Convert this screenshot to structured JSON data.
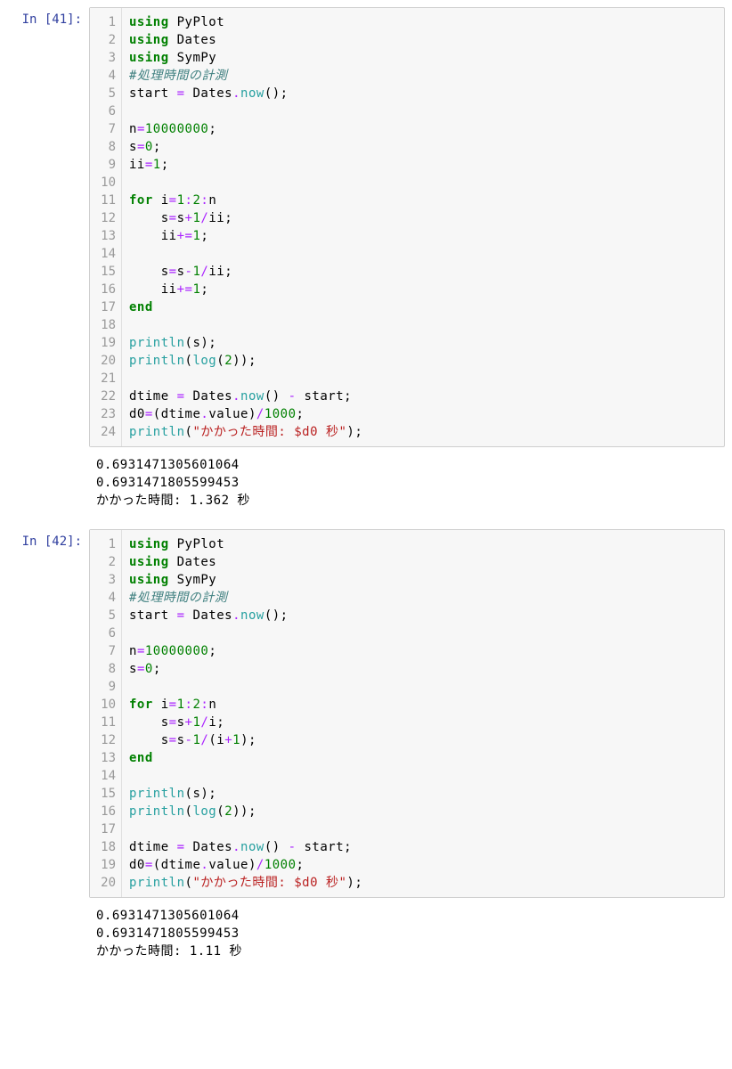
{
  "cells": [
    {
      "prompt": "In [41]:",
      "lineCount": 24,
      "code": [
        [
          {
            "c": "k",
            "t": "using"
          },
          {
            "c": "nm",
            "t": " PyPlot"
          }
        ],
        [
          {
            "c": "k",
            "t": "using"
          },
          {
            "c": "nm",
            "t": " Dates"
          }
        ],
        [
          {
            "c": "k",
            "t": "using"
          },
          {
            "c": "nm",
            "t": " SymPy"
          }
        ],
        [
          {
            "c": "cm",
            "t": "#処理時間の計測"
          }
        ],
        [
          {
            "c": "nm",
            "t": "start "
          },
          {
            "c": "op",
            "t": "="
          },
          {
            "c": "nm",
            "t": " Dates"
          },
          {
            "c": "op",
            "t": "."
          },
          {
            "c": "fn",
            "t": "now"
          },
          {
            "c": "nm",
            "t": "();"
          }
        ],
        [],
        [
          {
            "c": "nm",
            "t": "n"
          },
          {
            "c": "op",
            "t": "="
          },
          {
            "c": "nlit",
            "t": "10000000"
          },
          {
            "c": "nm",
            "t": ";"
          }
        ],
        [
          {
            "c": "nm",
            "t": "s"
          },
          {
            "c": "op",
            "t": "="
          },
          {
            "c": "nlit",
            "t": "0"
          },
          {
            "c": "nm",
            "t": ";"
          }
        ],
        [
          {
            "c": "nm",
            "t": "ii"
          },
          {
            "c": "op",
            "t": "="
          },
          {
            "c": "nlit",
            "t": "1"
          },
          {
            "c": "nm",
            "t": ";"
          }
        ],
        [],
        [
          {
            "c": "k",
            "t": "for"
          },
          {
            "c": "nm",
            "t": " i"
          },
          {
            "c": "op",
            "t": "="
          },
          {
            "c": "nlit",
            "t": "1"
          },
          {
            "c": "op",
            "t": ":"
          },
          {
            "c": "nlit",
            "t": "2"
          },
          {
            "c": "op",
            "t": ":"
          },
          {
            "c": "nm",
            "t": "n"
          }
        ],
        [
          {
            "c": "nm",
            "t": "    s"
          },
          {
            "c": "op",
            "t": "="
          },
          {
            "c": "nm",
            "t": "s"
          },
          {
            "c": "op",
            "t": "+"
          },
          {
            "c": "nlit",
            "t": "1"
          },
          {
            "c": "op",
            "t": "/"
          },
          {
            "c": "nm",
            "t": "ii;"
          }
        ],
        [
          {
            "c": "nm",
            "t": "    ii"
          },
          {
            "c": "op",
            "t": "+="
          },
          {
            "c": "nlit",
            "t": "1"
          },
          {
            "c": "nm",
            "t": ";"
          }
        ],
        [],
        [
          {
            "c": "nm",
            "t": "    s"
          },
          {
            "c": "op",
            "t": "="
          },
          {
            "c": "nm",
            "t": "s"
          },
          {
            "c": "op",
            "t": "-"
          },
          {
            "c": "nlit",
            "t": "1"
          },
          {
            "c": "op",
            "t": "/"
          },
          {
            "c": "nm",
            "t": "ii;"
          }
        ],
        [
          {
            "c": "nm",
            "t": "    ii"
          },
          {
            "c": "op",
            "t": "+="
          },
          {
            "c": "nlit",
            "t": "1"
          },
          {
            "c": "nm",
            "t": ";"
          }
        ],
        [
          {
            "c": "k",
            "t": "end"
          }
        ],
        [],
        [
          {
            "c": "fn",
            "t": "println"
          },
          {
            "c": "nm",
            "t": "(s);"
          }
        ],
        [
          {
            "c": "fn",
            "t": "println"
          },
          {
            "c": "nm",
            "t": "("
          },
          {
            "c": "fn",
            "t": "log"
          },
          {
            "c": "nm",
            "t": "("
          },
          {
            "c": "nlit",
            "t": "2"
          },
          {
            "c": "nm",
            "t": "));"
          }
        ],
        [],
        [
          {
            "c": "nm",
            "t": "dtime "
          },
          {
            "c": "op",
            "t": "="
          },
          {
            "c": "nm",
            "t": " Dates"
          },
          {
            "c": "op",
            "t": "."
          },
          {
            "c": "fn",
            "t": "now"
          },
          {
            "c": "nm",
            "t": "() "
          },
          {
            "c": "op",
            "t": "-"
          },
          {
            "c": "nm",
            "t": " start;"
          }
        ],
        [
          {
            "c": "nm",
            "t": "d0"
          },
          {
            "c": "op",
            "t": "="
          },
          {
            "c": "nm",
            "t": "(dtime"
          },
          {
            "c": "op",
            "t": "."
          },
          {
            "c": "nm",
            "t": "value)"
          },
          {
            "c": "op",
            "t": "/"
          },
          {
            "c": "nlit",
            "t": "1000"
          },
          {
            "c": "nm",
            "t": ";"
          }
        ],
        [
          {
            "c": "fn",
            "t": "println"
          },
          {
            "c": "nm",
            "t": "("
          },
          {
            "c": "str",
            "t": "\"かかった時間: $d0 秒\""
          },
          {
            "c": "nm",
            "t": ");"
          }
        ]
      ],
      "output": [
        "0.6931471305601064",
        "0.6931471805599453",
        "かかった時間: 1.362 秒"
      ]
    },
    {
      "prompt": "In [42]:",
      "lineCount": 20,
      "code": [
        [
          {
            "c": "k",
            "t": "using"
          },
          {
            "c": "nm",
            "t": " PyPlot"
          }
        ],
        [
          {
            "c": "k",
            "t": "using"
          },
          {
            "c": "nm",
            "t": " Dates"
          }
        ],
        [
          {
            "c": "k",
            "t": "using"
          },
          {
            "c": "nm",
            "t": " SymPy"
          }
        ],
        [
          {
            "c": "cm",
            "t": "#処理時間の計測"
          }
        ],
        [
          {
            "c": "nm",
            "t": "start "
          },
          {
            "c": "op",
            "t": "="
          },
          {
            "c": "nm",
            "t": " Dates"
          },
          {
            "c": "op",
            "t": "."
          },
          {
            "c": "fn",
            "t": "now"
          },
          {
            "c": "nm",
            "t": "();"
          }
        ],
        [],
        [
          {
            "c": "nm",
            "t": "n"
          },
          {
            "c": "op",
            "t": "="
          },
          {
            "c": "nlit",
            "t": "10000000"
          },
          {
            "c": "nm",
            "t": ";"
          }
        ],
        [
          {
            "c": "nm",
            "t": "s"
          },
          {
            "c": "op",
            "t": "="
          },
          {
            "c": "nlit",
            "t": "0"
          },
          {
            "c": "nm",
            "t": ";"
          }
        ],
        [],
        [
          {
            "c": "k",
            "t": "for"
          },
          {
            "c": "nm",
            "t": " i"
          },
          {
            "c": "op",
            "t": "="
          },
          {
            "c": "nlit",
            "t": "1"
          },
          {
            "c": "op",
            "t": ":"
          },
          {
            "c": "nlit",
            "t": "2"
          },
          {
            "c": "op",
            "t": ":"
          },
          {
            "c": "nm",
            "t": "n"
          }
        ],
        [
          {
            "c": "nm",
            "t": "    s"
          },
          {
            "c": "op",
            "t": "="
          },
          {
            "c": "nm",
            "t": "s"
          },
          {
            "c": "op",
            "t": "+"
          },
          {
            "c": "nlit",
            "t": "1"
          },
          {
            "c": "op",
            "t": "/"
          },
          {
            "c": "nm",
            "t": "i;"
          }
        ],
        [
          {
            "c": "nm",
            "t": "    s"
          },
          {
            "c": "op",
            "t": "="
          },
          {
            "c": "nm",
            "t": "s"
          },
          {
            "c": "op",
            "t": "-"
          },
          {
            "c": "nlit",
            "t": "1"
          },
          {
            "c": "op",
            "t": "/"
          },
          {
            "c": "nm",
            "t": "(i"
          },
          {
            "c": "op",
            "t": "+"
          },
          {
            "c": "nlit",
            "t": "1"
          },
          {
            "c": "nm",
            "t": ");"
          }
        ],
        [
          {
            "c": "k",
            "t": "end"
          }
        ],
        [],
        [
          {
            "c": "fn",
            "t": "println"
          },
          {
            "c": "nm",
            "t": "(s);"
          }
        ],
        [
          {
            "c": "fn",
            "t": "println"
          },
          {
            "c": "nm",
            "t": "("
          },
          {
            "c": "fn",
            "t": "log"
          },
          {
            "c": "nm",
            "t": "("
          },
          {
            "c": "nlit",
            "t": "2"
          },
          {
            "c": "nm",
            "t": "));"
          }
        ],
        [],
        [
          {
            "c": "nm",
            "t": "dtime "
          },
          {
            "c": "op",
            "t": "="
          },
          {
            "c": "nm",
            "t": " Dates"
          },
          {
            "c": "op",
            "t": "."
          },
          {
            "c": "fn",
            "t": "now"
          },
          {
            "c": "nm",
            "t": "() "
          },
          {
            "c": "op",
            "t": "-"
          },
          {
            "c": "nm",
            "t": " start;"
          }
        ],
        [
          {
            "c": "nm",
            "t": "d0"
          },
          {
            "c": "op",
            "t": "="
          },
          {
            "c": "nm",
            "t": "(dtime"
          },
          {
            "c": "op",
            "t": "."
          },
          {
            "c": "nm",
            "t": "value)"
          },
          {
            "c": "op",
            "t": "/"
          },
          {
            "c": "nlit",
            "t": "1000"
          },
          {
            "c": "nm",
            "t": ";"
          }
        ],
        [
          {
            "c": "fn",
            "t": "println"
          },
          {
            "c": "nm",
            "t": "("
          },
          {
            "c": "str",
            "t": "\"かかった時間: $d0 秒\""
          },
          {
            "c": "nm",
            "t": ");"
          }
        ]
      ],
      "output": [
        "0.6931471305601064",
        "0.6931471805599453",
        "かかった時間: 1.11 秒"
      ]
    }
  ]
}
